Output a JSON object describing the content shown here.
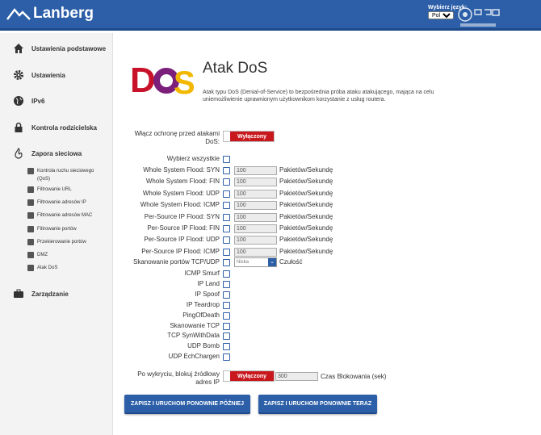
{
  "header": {
    "brand": "Lanberg",
    "lang_label": "Wybierz język:",
    "lang_value": "Polski"
  },
  "sidebar": {
    "main": [
      {
        "label": "Ustawienia podstawowe",
        "icon": "home-icon"
      },
      {
        "label": "Ustawienia",
        "icon": "gear-icon"
      },
      {
        "label": "IPv6",
        "icon": "globe-icon"
      },
      {
        "label": "Kontrola rodzicielska",
        "icon": "lock-icon"
      },
      {
        "label": "Zapora sieciowa",
        "icon": "firewall-icon"
      },
      {
        "label": "Zarządzanie",
        "icon": "briefcase-icon"
      }
    ],
    "sub": [
      "Kontrola ruchu sieciowego (QoS)",
      "Filtrowanie URL",
      "Filtrowanie adresów IP",
      "Filtrowanie adresów MAC",
      "Filtrowanie portów",
      "Przekierowanie portów",
      "DMZ",
      "Atak DoS"
    ]
  },
  "page": {
    "title": "Atak DoS",
    "logo_text": "DoS",
    "description": "Atak typu DoS (Denial-of-Service) to bezpośrednia próba ataku atakującego, mająca na celu uniemożliwienie uprawnionym użytkownikom korzystanie z usług routera.",
    "enable_label": "Włącz ochronę przed atakami DoS:",
    "toggle_off": "Wyłączony",
    "select_all": "Wybierz wszystkie",
    "unit": "Pakietów/Sekundę",
    "floods": [
      {
        "label": "Whole System Flood: SYN",
        "value": "100"
      },
      {
        "label": "Whole System Flood: FIN",
        "value": "100"
      },
      {
        "label": "Whole System Flood: UDP",
        "value": "100"
      },
      {
        "label": "Whole System Flood: ICMP",
        "value": "100"
      },
      {
        "label": "Per-Source IP Flood: SYN",
        "value": "100"
      },
      {
        "label": "Per-Source IP Flood: FIN",
        "value": "100"
      },
      {
        "label": "Per-Source IP Flood: UDP",
        "value": "100"
      },
      {
        "label": "Per-Source IP Flood: ICMP",
        "value": "100"
      }
    ],
    "portscan_label": "Skanowanie portów TCP/UDP",
    "portscan_select": "Niska",
    "portscan_sens": "Czułość",
    "checks": [
      "ICMP Smurf",
      "IP Land",
      "IP Spoof",
      "IP Teardrop",
      "PingOfDeath",
      "Skanowanie TCP",
      "TCP SynWithData",
      "UDP Bomb",
      "UDP EchChargen"
    ],
    "block_label": "Po wykryciu, blokuj źródłowy adres IP",
    "block_value": "300",
    "block_unit": "Czas Blokowania (sek)",
    "btn_later": "ZAPISZ I URUCHOM PONOWNIE PÓŹNIEJ",
    "btn_now": "ZAPISZ I URUCHOM PONOWNIE TERAZ"
  }
}
